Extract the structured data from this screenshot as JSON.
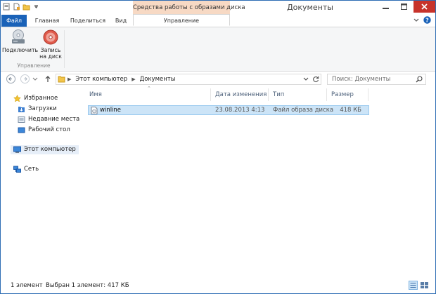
{
  "window": {
    "title": "Документы",
    "context_tab_title": "Средства работы с образами диска"
  },
  "tabs": {
    "file": "Файл",
    "home": "Главная",
    "share": "Поделиться",
    "view": "Вид",
    "manage": "Управление"
  },
  "ribbon": {
    "mount_label_1": "Подключить",
    "burn_label_1": "Запись",
    "burn_label_2": "на диск",
    "group_label": "Управление"
  },
  "address": {
    "crumbs": [
      "Этот компьютер",
      "Документы"
    ]
  },
  "search": {
    "placeholder": "Поиск: Документы"
  },
  "navpane": {
    "favorites": "Избранное",
    "downloads": "Загрузки",
    "recent": "Недавние места",
    "desktop": "Рабочий стол",
    "this_pc": "Этот компьютер",
    "network": "Сеть"
  },
  "columns": {
    "name": "Имя",
    "date": "Дата изменения",
    "type": "Тип",
    "size": "Размер"
  },
  "files": [
    {
      "name": "winline",
      "date": "23.08.2013 4:13",
      "type": "Файл образа диска",
      "size": "418 КБ"
    }
  ],
  "status": {
    "count": "1 элемент",
    "selected": "Выбран 1 элемент: 417 КБ"
  },
  "colors": {
    "file_tab": "#1a62b8",
    "context_tab": "#f7d9c4",
    "selection": "#cce4f7",
    "close_button": "#c7332b"
  }
}
